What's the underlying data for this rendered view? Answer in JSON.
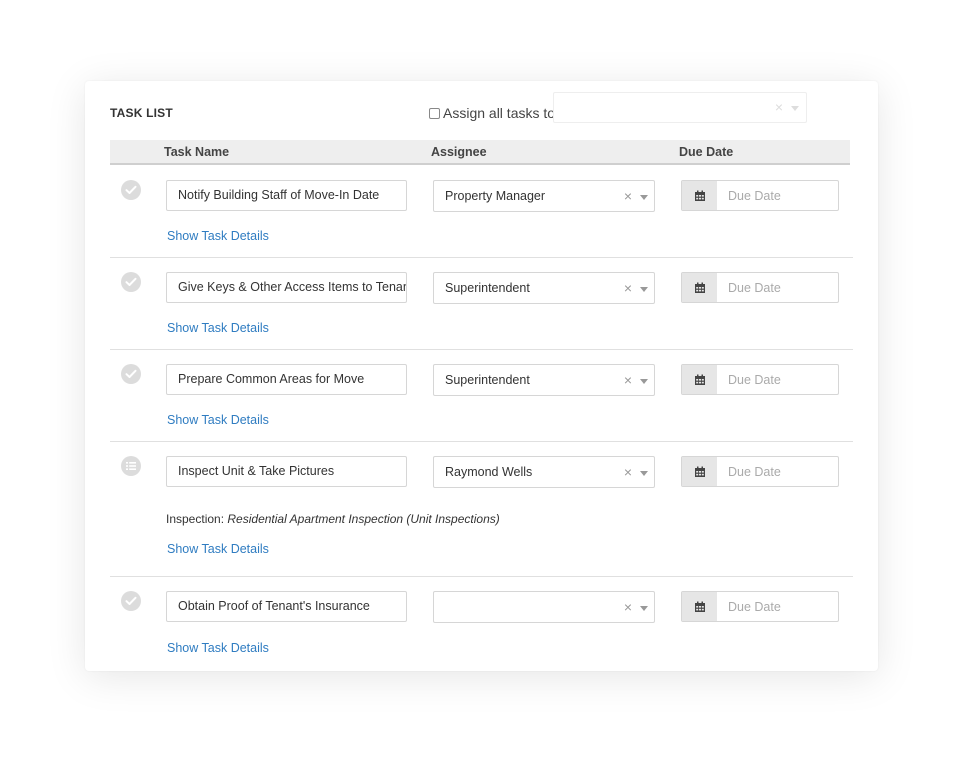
{
  "panel": {
    "title": "TASK LIST",
    "assign_all_label": "Assign all tasks to",
    "assign_all_value": "",
    "clear_symbol": "×"
  },
  "table": {
    "headers": {
      "task_name": "Task Name",
      "assignee": "Assignee",
      "due_date": "Due Date"
    }
  },
  "tasks": [
    {
      "name": "Notify Building Staff of Move-In Date",
      "assignee": "Property Manager",
      "due_placeholder": "Due Date",
      "status_icon": "check-circle-icon",
      "details_label": "Show Task Details"
    },
    {
      "name": "Give Keys & Other Access Items to Tenant",
      "assignee": "Superintendent",
      "due_placeholder": "Due Date",
      "status_icon": "check-circle-icon",
      "details_label": "Show Task Details"
    },
    {
      "name": "Prepare Common Areas for Move",
      "assignee": "Superintendent",
      "due_placeholder": "Due Date",
      "status_icon": "check-circle-icon",
      "details_label": "Show Task Details"
    },
    {
      "name": "Inspect Unit & Take Pictures",
      "assignee": "Raymond Wells",
      "due_placeholder": "Due Date",
      "status_icon": "list-circle-icon",
      "inspection_label": "Inspection:",
      "inspection_value": "Residential Apartment Inspection (Unit Inspections)",
      "details_label": "Show Task Details"
    },
    {
      "name": "Obtain Proof of Tenant's Insurance",
      "assignee": "",
      "due_placeholder": "Due Date",
      "status_icon": "check-circle-icon",
      "details_label": "Show Task Details"
    }
  ],
  "colors": {
    "link": "#2f7cc1",
    "header_bg": "#eeeeee",
    "icon_gray": "#dcdcdc"
  }
}
